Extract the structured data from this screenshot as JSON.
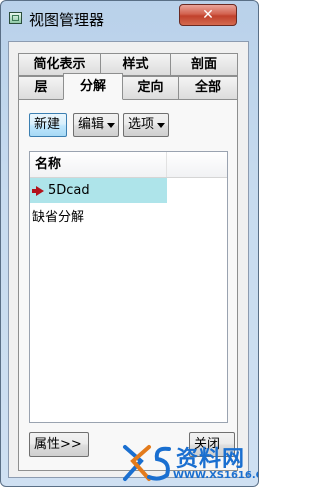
{
  "window": {
    "title": "视图管理器",
    "close_glyph": "✕"
  },
  "tabs": {
    "row1": [
      {
        "label": "简化表示"
      },
      {
        "label": "样式"
      },
      {
        "label": "剖面"
      }
    ],
    "row2": [
      {
        "label": "层"
      },
      {
        "label": "分解",
        "active": true
      },
      {
        "label": "定向"
      },
      {
        "label": "全部"
      }
    ]
  },
  "toolbar": {
    "new_label": "新建",
    "edit_label": "编辑",
    "options_label": "选项"
  },
  "list": {
    "column_header": "名称",
    "rows": [
      {
        "label": "5Dcad",
        "selected": true,
        "active": true
      },
      {
        "label": "缺省分解",
        "selected": false
      }
    ]
  },
  "footer": {
    "properties_label": "属性>>",
    "close_label": "关闭"
  },
  "watermark": {
    "text": "资料网",
    "url": "WWW.XS1616.COM"
  },
  "colors": {
    "selection": "#aee4ea",
    "active_arrow": "#b3121b",
    "close_button": "#c1412c"
  }
}
